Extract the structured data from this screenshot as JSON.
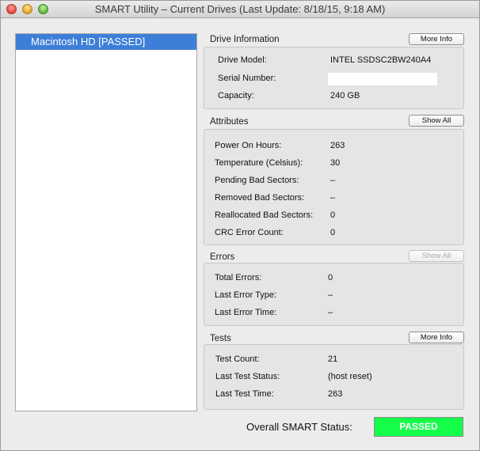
{
  "window": {
    "title": "SMART Utility – Current Drives (Last Update: 8/18/15, 9:18 AM)"
  },
  "drives": [
    {
      "label": "Macintosh HD  [PASSED]"
    }
  ],
  "drive_info": {
    "title": "Drive Information",
    "button": "More Info",
    "rows": [
      {
        "label": "Drive Model:",
        "value": "INTEL SSDSC2BW240A4"
      },
      {
        "label": "Serial Number:",
        "value": ""
      },
      {
        "label": "Capacity:",
        "value": "240 GB"
      }
    ]
  },
  "attributes": {
    "title": "Attributes",
    "button": "Show All",
    "rows": [
      {
        "label": "Power On Hours:",
        "value": "263"
      },
      {
        "label": "Temperature (Celsius):",
        "value": "30"
      },
      {
        "label": "Pending Bad Sectors:",
        "value": "–"
      },
      {
        "label": "Removed Bad Sectors:",
        "value": "–"
      },
      {
        "label": "Reallocated Bad Sectors:",
        "value": "0"
      },
      {
        "label": "CRC Error Count:",
        "value": "0"
      }
    ]
  },
  "errors": {
    "title": "Errors",
    "button": "Show All",
    "rows": [
      {
        "label": "Total Errors:",
        "value": "0"
      },
      {
        "label": "Last Error Type:",
        "value": "–"
      },
      {
        "label": "Last Error Time:",
        "value": "–"
      }
    ]
  },
  "tests": {
    "title": "Tests",
    "button": "More Info",
    "rows": [
      {
        "label": "Test Count:",
        "value": "21"
      },
      {
        "label": "Last Test Status:",
        "value": "(host reset)"
      },
      {
        "label": "Last Test Time:",
        "value": "263"
      }
    ]
  },
  "overall": {
    "label": "Overall SMART Status:",
    "status": "PASSED",
    "status_color": "#15fe4a"
  },
  "colors": {
    "selection": "#3d7fd8"
  }
}
